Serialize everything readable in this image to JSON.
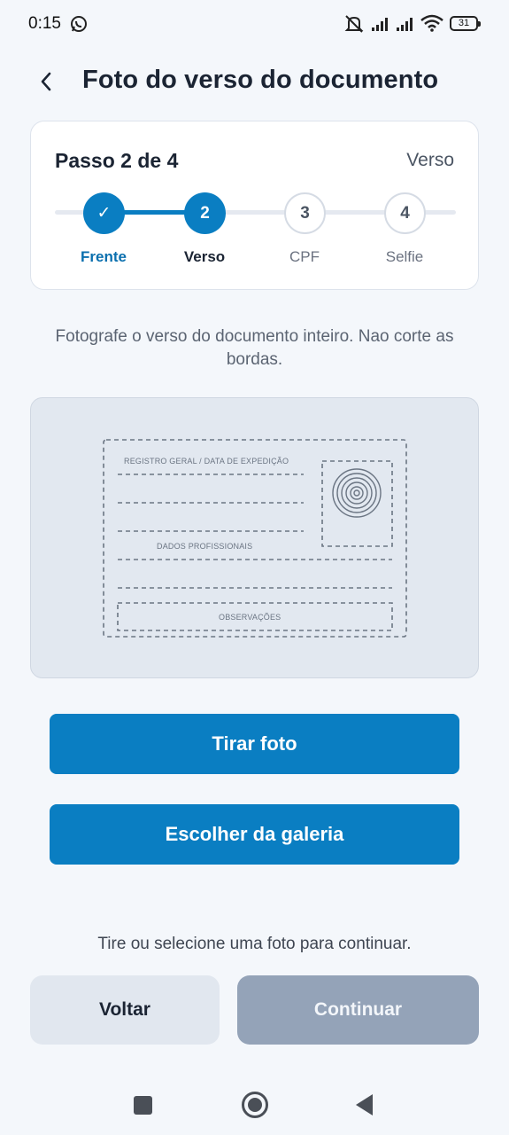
{
  "status_bar": {
    "time": "0:15",
    "battery": "31",
    "icons": [
      "whatsapp-icon",
      "mute-icon",
      "signal-icon",
      "signal-icon",
      "wifi-icon",
      "battery-icon"
    ]
  },
  "header": {
    "back_icon": "chevron-left-icon",
    "title": "Foto do verso do documento"
  },
  "stepper": {
    "count_label": "Passo 2 de 4",
    "current_label": "Verso",
    "steps": [
      {
        "marker": "✓",
        "label": "Frente",
        "state": "done"
      },
      {
        "marker": "2",
        "label": "Verso",
        "state": "active"
      },
      {
        "marker": "3",
        "label": "CPF",
        "state": "pending"
      },
      {
        "marker": "4",
        "label": "Selfie",
        "state": "pending"
      }
    ]
  },
  "instruction": "Fotografe o verso do documento inteiro. Nao corte as bordas.",
  "document_preview": {
    "registro_label": "REGISTRO GERAL / DATA DE EXPEDIÇÃO",
    "dados_label": "DADOS PROFISSIONAIS",
    "observacoes_label": "OBSERVAÇÕES"
  },
  "buttons": {
    "take_photo": "Tirar foto",
    "gallery": "Escolher da galeria",
    "back": "Voltar",
    "continue": "Continuar"
  },
  "hint": "Tire ou selecione uma foto para continuar.",
  "colors": {
    "primary": "#0a7ec2",
    "disabled": "#94a3b8",
    "background": "#f4f7fb"
  }
}
